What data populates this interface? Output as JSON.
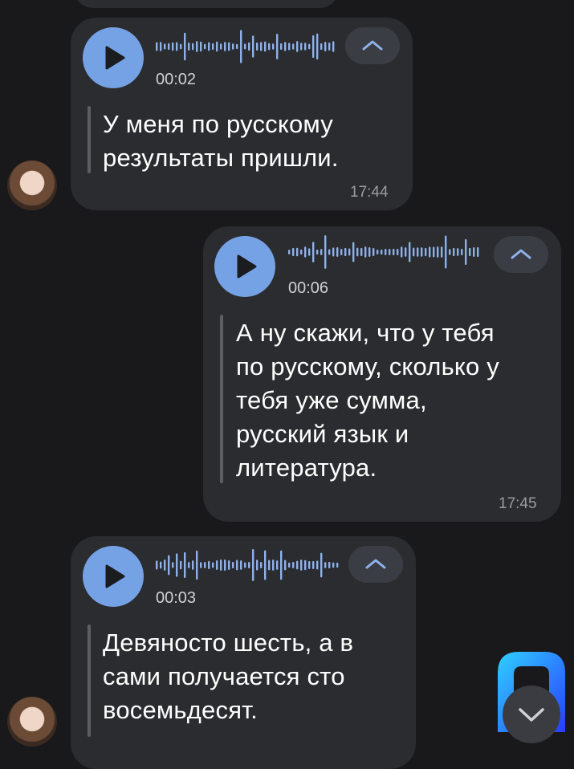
{
  "messages": [
    {
      "direction": "incoming",
      "duration": "00:02",
      "text": "У меня по русскому\nрезультаты пришли.",
      "time": "17:44"
    },
    {
      "direction": "outgoing",
      "duration": "00:06",
      "text": "А ну скажи, что у тебя\nпо русскому, сколько у\nтебя уже сумма,\nрусский язык и\nлитература.",
      "time": "17:45"
    },
    {
      "direction": "incoming",
      "duration": "00:03",
      "text": "Девяносто шесть, а в\nсами получается сто\nвосемьдесят.",
      "time": ""
    }
  ],
  "icons": {
    "play": "play-icon",
    "collapse": "chevron-up-icon",
    "scroll_down": "chevron-down-icon",
    "logo": "app-logo"
  },
  "colors": {
    "background": "#19191b",
    "bubble": "#2b2c2f",
    "accent": "#75a2e5",
    "waveform": "#8fb1ea"
  }
}
